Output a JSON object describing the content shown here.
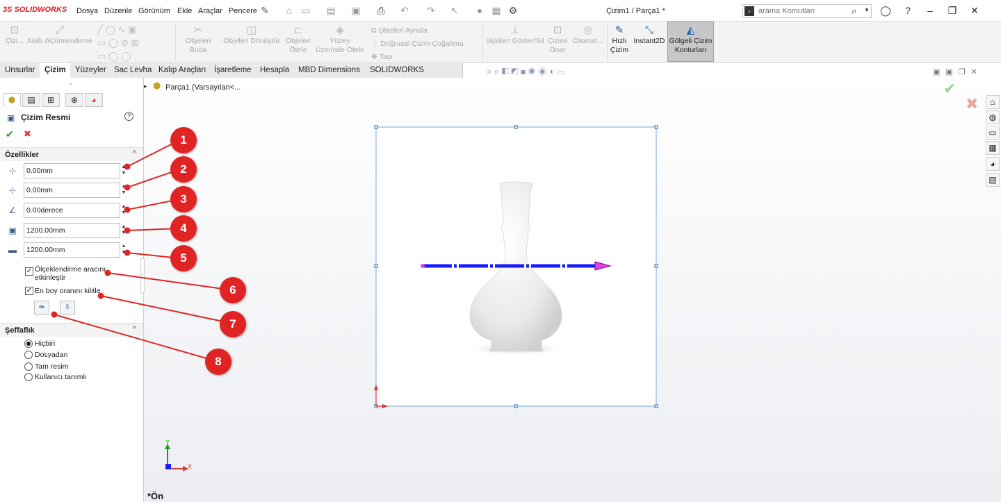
{
  "app": {
    "logo_text": "SOLIDWORKS",
    "logo_prefix": "3S",
    "doc_title": "Çizim1 / Parça1 *"
  },
  "menu": [
    "Dosya",
    "Düzenle",
    "Görünüm",
    "Ekle",
    "Araçlar",
    "Pencere"
  ],
  "search": {
    "placeholder": "arama Komutları"
  },
  "commands": [
    {
      "label": "Çizi...",
      "icon": "sketch-icon"
    },
    {
      "label": "Akıllı ölçümlendirme",
      "icon": "smart-dimension-icon"
    },
    {
      "label": "Objeleri Buda",
      "icon": "trim-icon"
    },
    {
      "label": "Objeleri Dönüştür",
      "icon": "convert-icon"
    },
    {
      "label": "Objeleri Ötele",
      "icon": "offset-icon"
    },
    {
      "label": "Yüzey Üzerinde Ötele",
      "icon": "surface-offset-icon"
    },
    {
      "label": "Objeleri Aynala",
      "icon": "mirror-icon"
    },
    {
      "label": "Doğrusal Çizim Çoğaltma",
      "icon": "linear-pattern-icon"
    },
    {
      "label": "Taşı",
      "icon": "move-icon"
    },
    {
      "label": "İlişkileri Göster/Sil",
      "icon": "relations-icon"
    },
    {
      "label": "Çizimi Onar",
      "icon": "repair-icon"
    },
    {
      "label": "Otomat...",
      "icon": "auto-icon"
    },
    {
      "label": "Hızlı Çizim",
      "icon": "rapid-sketch-icon"
    },
    {
      "label": "Instant2D",
      "icon": "instant2d-icon"
    },
    {
      "label": "Gölgeli Çizim Konturları",
      "icon": "shaded-contours-icon"
    }
  ],
  "tabs": [
    "Unsurlar",
    "Çizim",
    "Yüzeyler",
    "Sac Levha",
    "Kalıp Araçları",
    "İşaretleme",
    "Hesapla",
    "MBD Dimensions",
    "SOLIDWORKS Eklentileri"
  ],
  "tree": {
    "root_label": "Parça1  (Varsayılan<..."
  },
  "panel": {
    "title": "Çizim Resmi",
    "properties_header": "Özellikler",
    "fields": [
      "0.00mm",
      "0.00mm",
      "0.00derece",
      "1200.00mm",
      "1200.00mm"
    ],
    "checkbox1_label_line1": "Ölçeklendirme aracını",
    "checkbox1_label_line2": "etkinleştir",
    "checkbox2_label": "En boy oranını kilitle",
    "transparency_header": "Şeffaflık",
    "radios": [
      "Hiçbiri",
      "Dosyadan",
      "Tam resim",
      "Kullanıcı tanımlı"
    ]
  },
  "callouts": [
    "1",
    "2",
    "3",
    "4",
    "5",
    "6",
    "7",
    "8"
  ],
  "view_label": "*Ön",
  "axes": {
    "y": "Y",
    "x": "X"
  },
  "colors": {
    "callout": "#e02424",
    "selection_box": "#7fa6d3",
    "arrow": "#1a1aff",
    "arrow_head": "#e040e0"
  }
}
